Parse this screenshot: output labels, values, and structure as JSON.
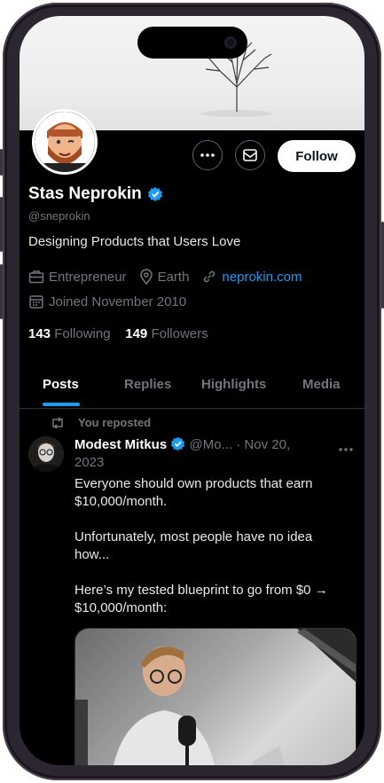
{
  "profile": {
    "name": "Stas Neprokin",
    "handle": "@sneprokin",
    "bio": "Designing Products that Users Love",
    "occupation": "Entrepreneur",
    "location": "Earth",
    "website": "neprokin.com",
    "joined": "Joined November 2010",
    "following_count": "143",
    "following_label": "Following",
    "followers_count": "149",
    "followers_label": "Followers"
  },
  "actions": {
    "follow_label": "Follow",
    "more_icon": "more-icon",
    "message_icon": "mail-icon"
  },
  "tabs": [
    {
      "label": "Posts",
      "active": true
    },
    {
      "label": "Replies"
    },
    {
      "label": "Highlights"
    },
    {
      "label": "Media"
    }
  ],
  "post": {
    "repost_label": "You reposted",
    "author": "Modest Mitkus",
    "handle_date": "@Mo... · Nov 20, 2023",
    "text": "Everyone should own products that earn $10,000/month.\n\nUnfortunately, most people have no idea how...\n\nHere’s my tested blueprint to go from $0 → $10,000/month:"
  },
  "colors": {
    "accent": "#1d9bf0",
    "background": "#000000",
    "muted": "#71767b"
  }
}
